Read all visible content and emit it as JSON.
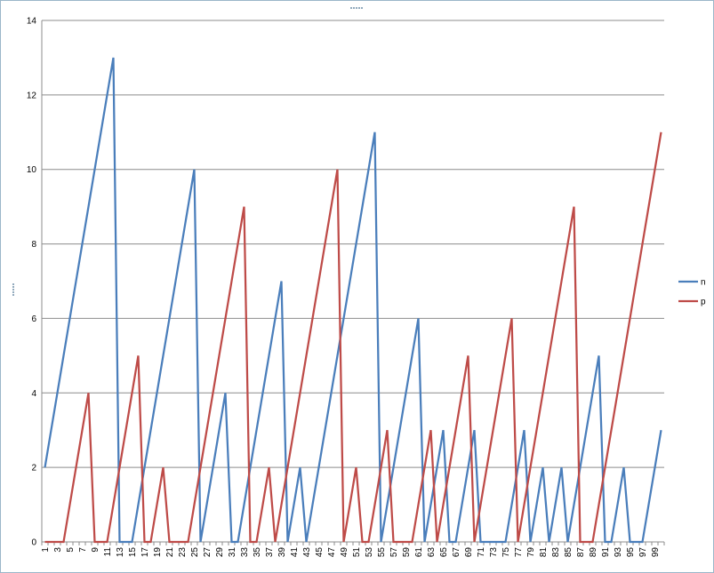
{
  "chart_data": {
    "type": "line",
    "title": "",
    "xlabel": "",
    "ylabel": "",
    "ylim": [
      0,
      14
    ],
    "yticks": [
      0,
      2,
      4,
      6,
      8,
      10,
      12,
      14
    ],
    "grid": true,
    "legend_position": "right",
    "x": [
      1,
      2,
      3,
      4,
      5,
      6,
      7,
      8,
      9,
      10,
      11,
      12,
      13,
      14,
      15,
      16,
      17,
      18,
      19,
      20,
      21,
      22,
      23,
      24,
      25,
      26,
      27,
      28,
      29,
      30,
      31,
      32,
      33,
      34,
      35,
      36,
      37,
      38,
      39,
      40,
      41,
      42,
      43,
      44,
      45,
      46,
      47,
      48,
      49,
      50,
      51,
      52,
      53,
      54,
      55,
      56,
      57,
      58,
      59,
      60,
      61,
      62,
      63,
      64,
      65,
      66,
      67,
      68,
      69,
      70,
      71,
      72,
      73,
      74,
      75,
      76,
      77,
      78,
      79,
      80,
      81,
      82,
      83,
      84,
      85,
      86,
      87,
      88,
      89,
      90,
      91,
      92,
      93,
      94,
      95,
      96,
      97,
      98,
      99,
      100
    ],
    "xtick_labels": [
      "1",
      "3",
      "5",
      "7",
      "9",
      "11",
      "13",
      "15",
      "17",
      "19",
      "21",
      "23",
      "25",
      "27",
      "29",
      "31",
      "33",
      "35",
      "37",
      "39",
      "41",
      "43",
      "45",
      "47",
      "49",
      "51",
      "53",
      "55",
      "57",
      "59",
      "61",
      "63",
      "65",
      "67",
      "69",
      "71",
      "73",
      "75",
      "77",
      "79",
      "81",
      "83",
      "85",
      "87",
      "89",
      "91",
      "93",
      "95",
      "97",
      "99"
    ],
    "series": [
      {
        "name": "n",
        "color": "#4a7ebb",
        "values": [
          2,
          3,
          4,
          5,
          6,
          7,
          8,
          9,
          10,
          11,
          12,
          13,
          0,
          0,
          0,
          1,
          2,
          3,
          4,
          5,
          6,
          7,
          8,
          9,
          10,
          0,
          1,
          2,
          3,
          4,
          0,
          0,
          1,
          2,
          3,
          4,
          5,
          6,
          7,
          0,
          1,
          2,
          0,
          1,
          2,
          3,
          4,
          5,
          6,
          7,
          8,
          9,
          10,
          11,
          0,
          1,
          2,
          3,
          4,
          5,
          6,
          0,
          1,
          2,
          3,
          0,
          0,
          1,
          2,
          3,
          0,
          0,
          0,
          0,
          0,
          1,
          2,
          3,
          0,
          1,
          2,
          0,
          1,
          2,
          0,
          1,
          2,
          3,
          4,
          5,
          0,
          0,
          1,
          2,
          0,
          0,
          0,
          1,
          2,
          3
        ]
      },
      {
        "name": "p",
        "color": "#be4b48",
        "values": [
          0,
          0,
          0,
          0,
          1,
          2,
          3,
          4,
          0,
          0,
          0,
          1,
          2,
          3,
          4,
          5,
          0,
          0,
          1,
          2,
          0,
          0,
          0,
          0,
          1,
          2,
          3,
          4,
          5,
          6,
          7,
          8,
          9,
          0,
          0,
          1,
          2,
          0,
          1,
          2,
          3,
          4,
          5,
          6,
          7,
          8,
          9,
          10,
          0,
          1,
          2,
          0,
          0,
          1,
          2,
          3,
          0,
          0,
          0,
          0,
          1,
          2,
          3,
          0,
          1,
          2,
          3,
          4,
          5,
          0,
          1,
          2,
          3,
          4,
          5,
          6,
          0,
          1,
          2,
          3,
          4,
          5,
          6,
          7,
          8,
          9,
          0,
          0,
          0,
          1,
          2,
          3,
          4,
          5,
          6,
          7,
          8,
          9,
          10,
          11
        ]
      }
    ]
  }
}
